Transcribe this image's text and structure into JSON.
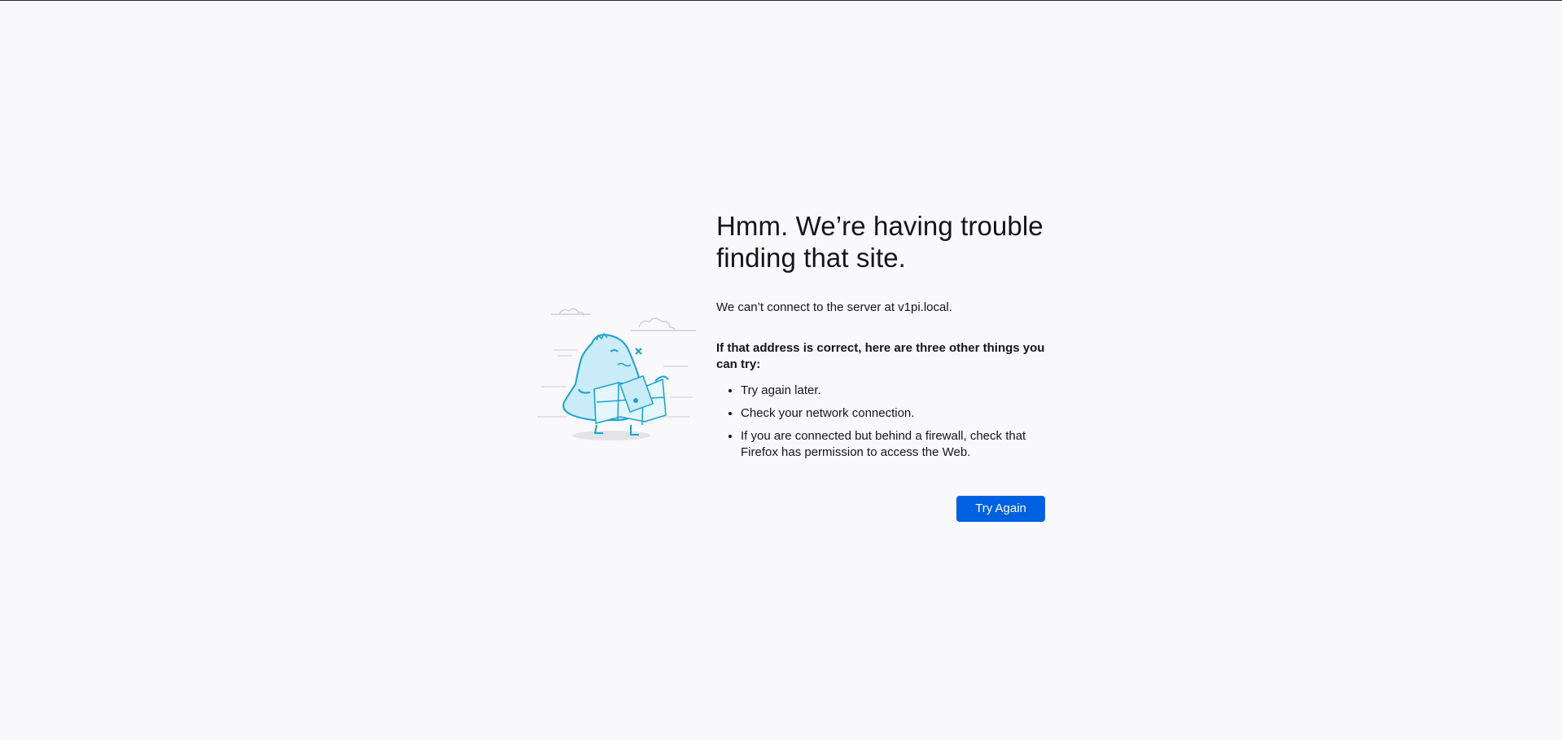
{
  "error_page": {
    "title": "Hmm. We’re having trouble finding that site.",
    "description": "We can’t connect to the server at v1pi.local.",
    "suggestions_heading": "If that address is correct, here are three other things you can try:",
    "suggestions": [
      "Try again later.",
      "Check your network connection.",
      "If you are connected but behind a firewall, check that Firefox has permission to access the Web."
    ],
    "try_again_label": "Try Again"
  },
  "colors": {
    "background": "#f9f9fb",
    "text": "#15141a",
    "button": "#0061e0",
    "button_text": "#fbfbfe",
    "illustration_stroke": "#1aa1d0",
    "illustration_fill": "#c9ecf8"
  },
  "icons": {
    "illustration": "confused-dino-with-map-illustration"
  }
}
